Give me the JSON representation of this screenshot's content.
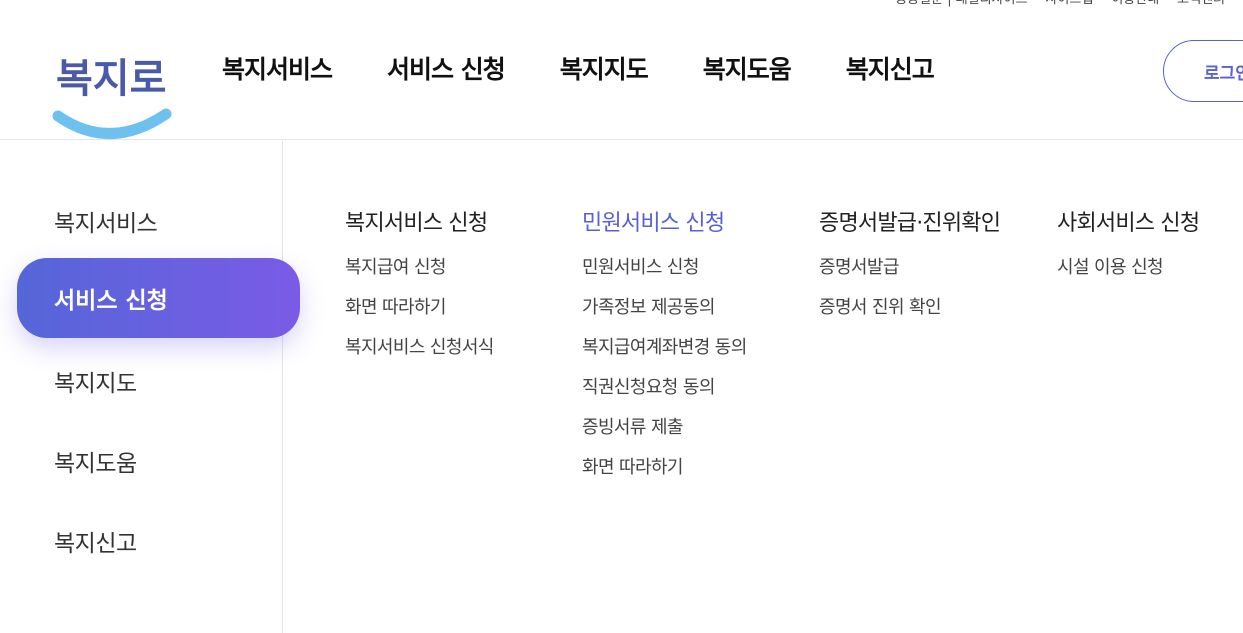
{
  "util_bar": [
    "공공질문 | 패밀리사이트",
    "사이트맵",
    "이용안내",
    "고객센터"
  ],
  "logo": {
    "text": "복지로",
    "colors": {
      "text": "#4a5aa8",
      "smile": "#6ec1ef"
    }
  },
  "gnb": [
    "복지서비스",
    "서비스 신청",
    "복지지도",
    "복지도움",
    "복지신고"
  ],
  "login": {
    "label": "로그인"
  },
  "side_menu": {
    "items": [
      "복지서비스",
      "서비스 신청",
      "복지지도",
      "복지도움",
      "복지신고"
    ],
    "active": "서비스 신청"
  },
  "columns": [
    {
      "title": "복지서비스 신청",
      "links": [
        "복지급여 신청",
        "화면 따라하기",
        "복지서비스 신청서식"
      ]
    },
    {
      "title": "민원서비스 신청",
      "links": [
        "민원서비스 신청",
        "가족정보 제공동의",
        "복지급여계좌변경 동의",
        "직권신청요청 동의",
        "증빙서류 제출",
        "화면 따라하기"
      ]
    },
    {
      "title": "증명서발급·진위확인",
      "links": [
        "증명서발급",
        "증명서 진위 확인"
      ]
    },
    {
      "title": "사회서비스 신청",
      "links": [
        "시설 이용 신청"
      ]
    }
  ],
  "colors": {
    "accent": "#5b5fd6",
    "gradient_start": "#5566d8",
    "gradient_end": "#7a5be6"
  }
}
